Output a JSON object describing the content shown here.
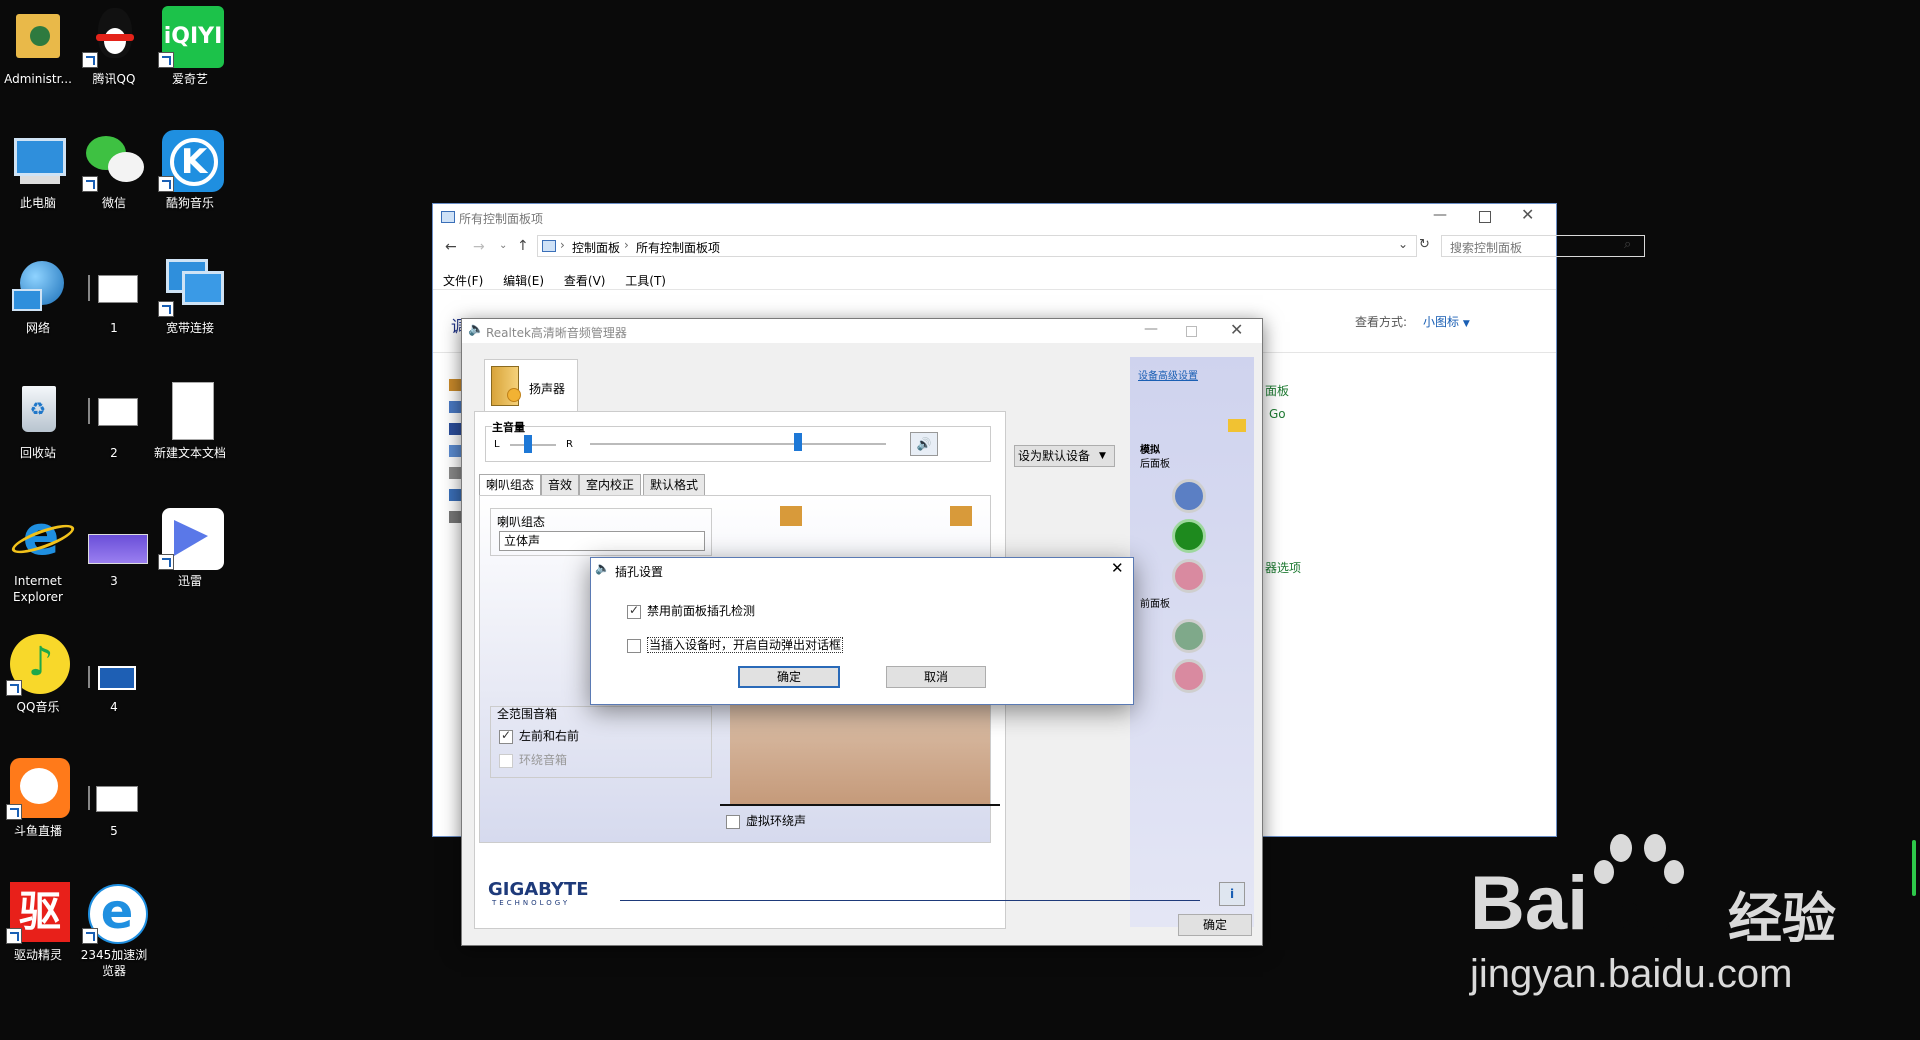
{
  "desktop": {
    "icons": [
      {
        "label": "Administr..."
      },
      {
        "label": "腾讯QQ"
      },
      {
        "label": "爱奇艺"
      },
      {
        "label": "此电脑"
      },
      {
        "label": "微信"
      },
      {
        "label": "酷狗音乐"
      },
      {
        "label": "网络"
      },
      {
        "label": "1"
      },
      {
        "label": "宽带连接"
      },
      {
        "label": "回收站"
      },
      {
        "label": "2"
      },
      {
        "label": "新建文本文档"
      },
      {
        "label": "Internet Explorer"
      },
      {
        "label": "3"
      },
      {
        "label": "迅雷"
      },
      {
        "label": "QQ音乐"
      },
      {
        "label": "4"
      },
      {
        "label": "斗鱼直播"
      },
      {
        "label": "5"
      },
      {
        "label": "驱动精灵"
      },
      {
        "label": "2345加速浏览器"
      }
    ],
    "iqiyi_logo": "iQIYI",
    "qudong_logo": "驱"
  },
  "control_panel": {
    "title": "所有控制面板项",
    "breadcrumb": [
      "控制面板",
      "所有控制面板项"
    ],
    "search_placeholder": "搜索控制面板",
    "menu": [
      "文件(F)",
      "编辑(E)",
      "查看(V)",
      "工具(T)"
    ],
    "heading": "调整计算机的设置",
    "view_by_label": "查看方式:",
    "view_by_value": "小图标",
    "right_items": [
      "面板",
      "Go",
      "器选项"
    ]
  },
  "realtek": {
    "title": "Realtek高清晰音频管理器",
    "device_tab": "扬声器",
    "main_volume_label": "主音量",
    "left": "L",
    "right": "R",
    "set_default": "设为默认设备",
    "tabs": [
      "喇叭组态",
      "音效",
      "室内校正",
      "默认格式"
    ],
    "speaker_config_label": "喇叭组态",
    "speaker_config_value": "立体声",
    "full_range_label": "全范围音箱",
    "front_lr": "左前和右前",
    "surround": "环绕音箱",
    "virtual_surround": "虚拟环绕声",
    "device_advanced": "设备高级设置",
    "analog": "模拟",
    "back_panel": "后面板",
    "front_panel": "前面板",
    "brand": "GIGABYTE",
    "brand_sub": "TECHNOLOGY",
    "ok": "确定",
    "colors": {
      "blue": "#5b7fc4",
      "green": "#1e8a1e",
      "pink": "#d98aa0",
      "gray_green": "#7fa98a"
    }
  },
  "jack_dialog": {
    "title": "插孔设置",
    "opt1": "禁用前面板插孔检测",
    "opt1_checked": true,
    "opt2": "当插入设备时，开启自动弹出对话框",
    "opt2_checked": false,
    "ok": "确定",
    "cancel": "取消"
  },
  "watermark": {
    "brand": "Bai",
    "du": "du",
    "jingyan": "经验",
    "url": "jingyan.baidu.com"
  }
}
